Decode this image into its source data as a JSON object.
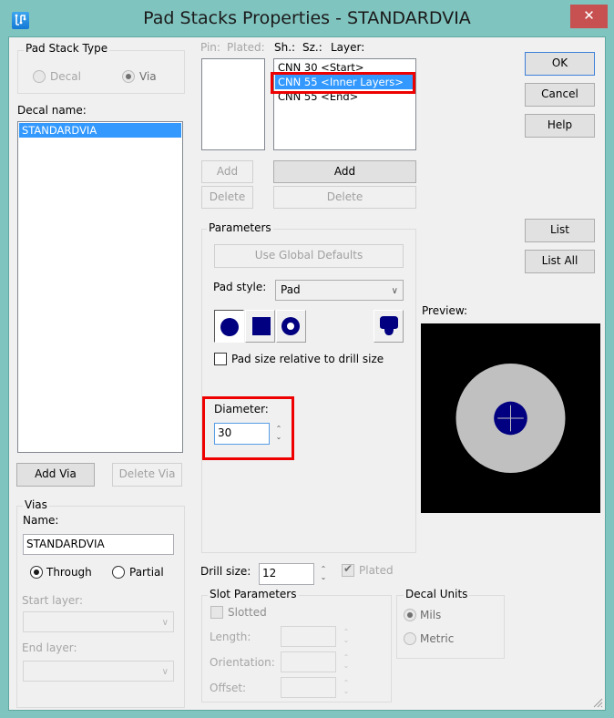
{
  "window": {
    "title": "Pad Stacks Properties - STANDARDVIA",
    "close_label": "✕",
    "app_icon": "pads-app-icon"
  },
  "pad_stack_type": {
    "group_label": "Pad Stack Type",
    "options": [
      {
        "label": "Decal",
        "checked": false,
        "enabled": false
      },
      {
        "label": "Via",
        "checked": true,
        "enabled": false
      }
    ]
  },
  "decal_name": {
    "label": "Decal name:",
    "items": [
      {
        "text": "STANDARDVIA",
        "selected": true
      }
    ]
  },
  "via_buttons": {
    "add_via": "Add Via",
    "delete_via": "Delete Via"
  },
  "vias": {
    "group_label": "Vias",
    "name_label": "Name:",
    "name_value": "STANDARDVIA",
    "through_label": "Through",
    "partial_label": "Partial",
    "through_checked": true,
    "start_layer_label": "Start layer:",
    "start_layer_value": "",
    "end_layer_label": "End layer:",
    "end_layer_value": ""
  },
  "pin_list": {
    "header_pin": "Pin:",
    "header_plated": "Plated:",
    "items": []
  },
  "layer_list": {
    "header_sh": "Sh.:",
    "header_sz": "Sz.:",
    "header_layer": "Layer:",
    "items": [
      {
        "text": "CNN 30 <Start>",
        "selected": false
      },
      {
        "text": "CNN 55 <Inner Layers>",
        "selected": true
      },
      {
        "text": "CNN 55 <End>",
        "selected": false
      }
    ]
  },
  "pin_buttons": {
    "add": "Add",
    "delete": "Delete"
  },
  "layer_buttons": {
    "add": "Add",
    "delete": "Delete"
  },
  "parameters": {
    "group_label": "Parameters",
    "use_global_defaults": "Use Global Defaults",
    "pad_style_label": "Pad style:",
    "pad_style_value": "Pad",
    "shapes": [
      {
        "name": "round",
        "pressed": true
      },
      {
        "name": "square",
        "pressed": false
      },
      {
        "name": "annular",
        "pressed": false
      },
      {
        "name": "custom",
        "pressed": false
      }
    ],
    "relative_checkbox_label": "Pad size relative to drill size",
    "relative_checked": false,
    "diameter_label": "Diameter:",
    "diameter_value": "30"
  },
  "drill": {
    "label": "Drill size:",
    "value": "12",
    "plated_label": "Plated",
    "plated_checked": true
  },
  "slot_parameters": {
    "group_label": "Slot Parameters",
    "slotted_label": "Slotted",
    "slotted_checked": false,
    "length_label": "Length:",
    "orientation_label": "Orientation:",
    "offset_label": "Offset:"
  },
  "decal_units": {
    "group_label": "Decal Units",
    "options": [
      {
        "label": "Mils",
        "checked": true
      },
      {
        "label": "Metric",
        "checked": false
      }
    ]
  },
  "dialog_buttons": {
    "ok": "OK",
    "cancel": "Cancel",
    "help": "Help",
    "list": "List",
    "list_all": "List All"
  },
  "preview": {
    "label": "Preview:",
    "background": "#000000",
    "pad_color": "#c0c0c0",
    "drill_color": "#000080",
    "pad_diameter": 55,
    "drill_diameter": 12
  },
  "highlight_color": "#ee0000"
}
